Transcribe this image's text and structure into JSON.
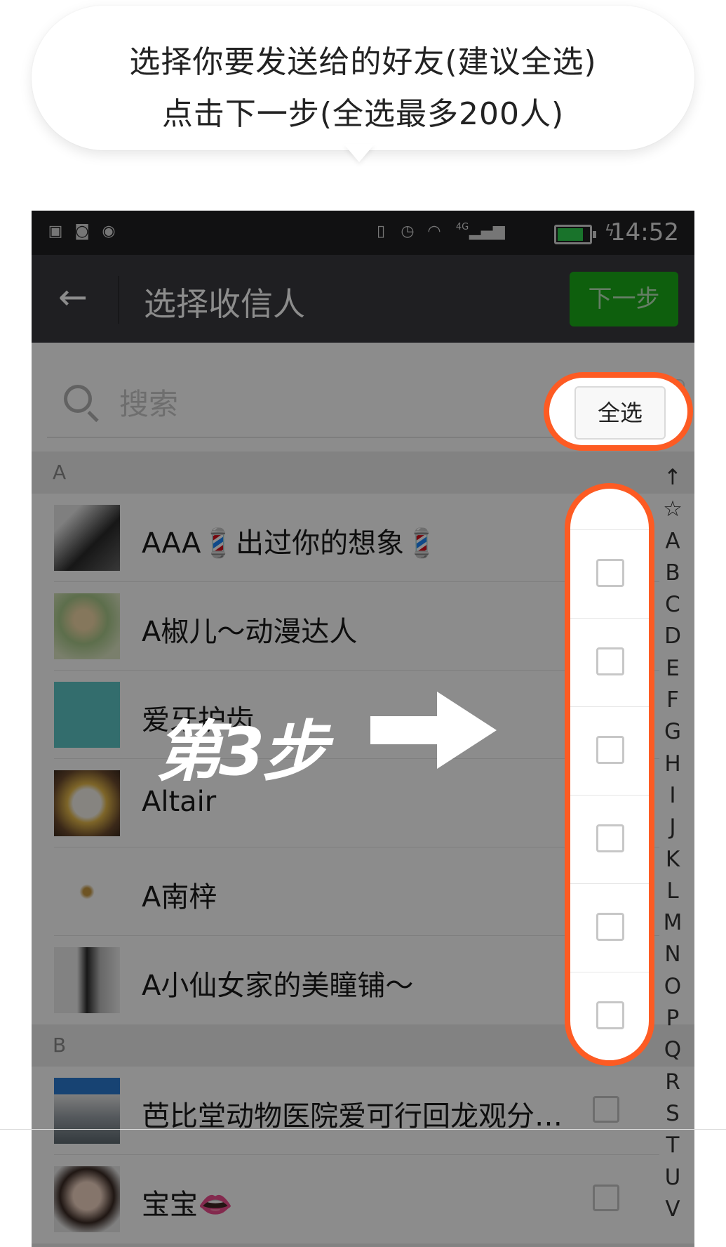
{
  "bubble": {
    "line1": "选择你要发送给的好友(建议全选)",
    "line2": "点击下一步(全选最多200人)"
  },
  "statusbar": {
    "time": "14:52",
    "network": "4G",
    "icons": [
      "image-icon",
      "android-icon",
      "record-icon",
      "vibrate-icon",
      "alarm-icon",
      "wifi-icon",
      "signal-icon",
      "battery-icon",
      "charging-icon"
    ]
  },
  "appbar": {
    "back_icon": "back-arrow-icon",
    "title": "选择收信人",
    "next_label": "下一步"
  },
  "search": {
    "placeholder": "搜索",
    "select_all_label": "全选"
  },
  "sections": [
    {
      "letter": "A",
      "contacts": [
        {
          "name": "AAA💈出过你的想象💈",
          "checked": false
        },
        {
          "name": "A椒儿～动漫达人",
          "checked": false
        },
        {
          "name": "爱牙护齿",
          "checked": false
        },
        {
          "name": "Altair",
          "checked": false
        },
        {
          "name": "A南梓",
          "checked": false
        },
        {
          "name": "A小仙女家的美瞳铺～",
          "checked": false
        }
      ]
    },
    {
      "letter": "B",
      "contacts": [
        {
          "name": "芭比堂动物医院爱可行回龙观分…",
          "checked": false
        },
        {
          "name": "宝宝👄",
          "checked": false
        }
      ]
    }
  ],
  "index_letters": [
    "↑",
    "☆",
    "A",
    "B",
    "C",
    "D",
    "E",
    "F",
    "G",
    "H",
    "I",
    "J",
    "K",
    "L",
    "M",
    "N",
    "O",
    "P",
    "Q",
    "R",
    "S",
    "T",
    "U",
    "V"
  ],
  "overlay": {
    "step_label": "第3步",
    "accent": "#fd5b23"
  }
}
